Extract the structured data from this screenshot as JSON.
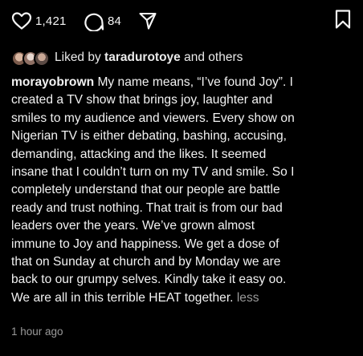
{
  "actions": {
    "likes_count": "1,421",
    "comments_count": "84",
    "icons": {
      "like": "heart-icon",
      "comment": "comment-bubble-icon",
      "share": "paper-plane-icon",
      "save": "bookmark-icon"
    }
  },
  "liked_by": {
    "prefix": "Liked by ",
    "user": "taradurotoye",
    "suffix": " and others"
  },
  "caption": {
    "author": "morayobrown",
    "lines": [
      " My name means, “I’ve found Joy”. I",
      "created a TV show that brings joy, laughter and",
      "smiles to my audience and viewers. Every show on",
      "Nigerian TV is either debating, bashing, accusing,",
      "demanding, attacking and the likes. It seemed",
      "insane that I couldn’t turn on my TV and smile. So I",
      "completely understand that our people are battle",
      "ready and trust nothing. That trait is from our bad",
      "leaders over the years. We’ve grown almost",
      "immune to Joy and happiness. We get a dose of",
      "that on Sunday at church and by Monday we are",
      "back to our grumpy selves. Kindly take it easy oo.",
      "We are all in this terrible HEAT together. "
    ],
    "less_label": "less"
  },
  "timestamp": "1 hour ago"
}
